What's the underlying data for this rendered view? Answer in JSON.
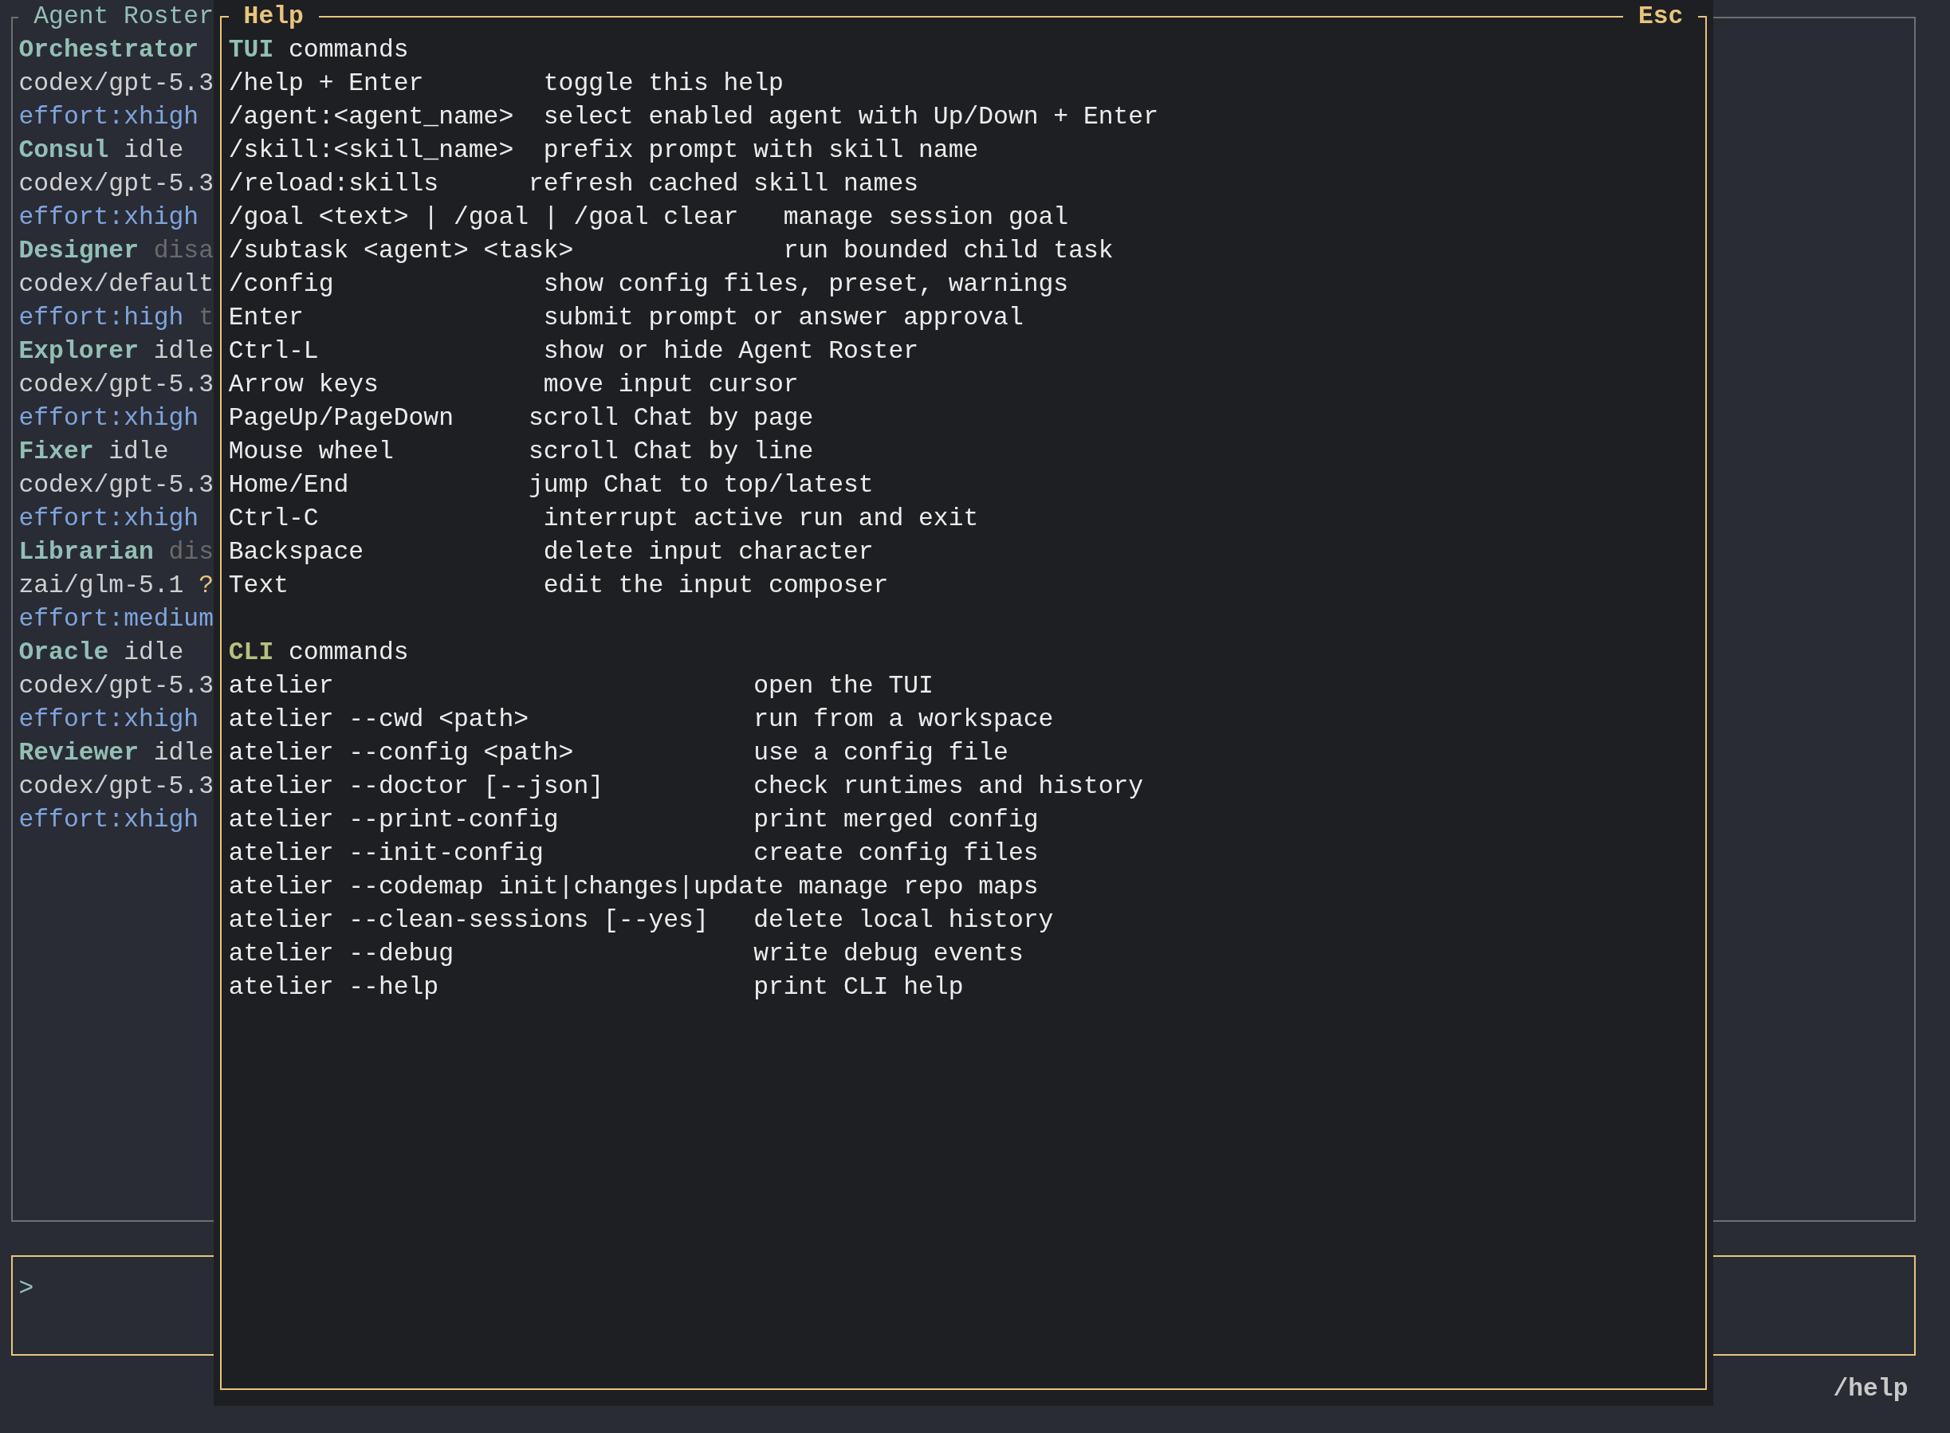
{
  "roster": {
    "title": "Agent Roster",
    "agents": [
      {
        "name": "Orchestrator",
        "model": "codex/gpt-5.3",
        "effort": "effort:xhigh"
      },
      {
        "name": "Consul",
        "status": {
          "text": "idle",
          "disabled": false
        },
        "model": "codex/gpt-5.3",
        "effort": "effort:xhigh"
      },
      {
        "name": "Designer",
        "status": {
          "text": "disa",
          "disabled": true
        },
        "model": "codex/default",
        "effort": "effort:high",
        "effort_trail": "t"
      },
      {
        "name": "Explorer",
        "status": {
          "text": "idle",
          "disabled": false
        },
        "model": "codex/gpt-5.3",
        "effort": "effort:xhigh"
      },
      {
        "name": "Fixer",
        "status": {
          "text": "idle",
          "disabled": false
        },
        "model": "codex/gpt-5.3",
        "effort": "effort:xhigh"
      },
      {
        "name": "Librarian",
        "status": {
          "text": "dis",
          "disabled": true
        },
        "model": "zai/glm-5.1",
        "model_suffix": "?",
        "effort": "effort:medium"
      },
      {
        "name": "Oracle",
        "status": {
          "text": "idle",
          "disabled": false
        },
        "model": "codex/gpt-5.3",
        "effort": "effort:xhigh"
      },
      {
        "name": "Reviewer",
        "status": {
          "text": "idle",
          "disabled": false
        },
        "model": "codex/gpt-5.3",
        "effort": "effort:xhigh"
      }
    ]
  },
  "help_dialog": {
    "title": "Help",
    "close_hint": "Esc",
    "sections": [
      {
        "kind": "tui",
        "heading": "**TUI** commands",
        "rows": [
          {
            "keys": "/help + Enter",
            "action": "toggle this help"
          },
          {
            "keys": "/agent:<agent_name>",
            "action": "select enabled agent with Up/Down + Enter"
          },
          {
            "keys": "/skill:<skill_name>",
            "action": "prefix prompt with skill name"
          },
          {
            "keys": "/reload:skills",
            "action": "refresh cached skill names"
          },
          {
            "keys": "/goal <text> | /goal | /goal clear",
            "action": "manage session goal"
          },
          {
            "keys": "/subtask <agent> <task>",
            "action": "run bounded child task"
          },
          {
            "keys": "/config",
            "action": "show config files, preset, warnings"
          },
          {
            "keys": "Enter",
            "action": "submit prompt or answer approval"
          },
          {
            "keys": "Ctrl-L",
            "action": "show or hide Agent Roster"
          },
          {
            "keys": "Arrow keys",
            "action": "move input cursor"
          },
          {
            "keys": "PageUp/PageDown",
            "action": "scroll Chat by page"
          },
          {
            "keys": "Mouse wheel",
            "action": "scroll Chat by line"
          },
          {
            "keys": "Home/End",
            "action": "jump Chat to top/latest"
          },
          {
            "keys": "Ctrl-C",
            "action": "interrupt active run and exit"
          },
          {
            "keys": "Backspace",
            "action": "delete input character"
          },
          {
            "keys": "Text",
            "action": "edit the input composer"
          }
        ]
      },
      {
        "kind": "cli",
        "heading": "**CLI** commands",
        "rows": [
          {
            "keys": "atelier",
            "action": "open the TUI"
          },
          {
            "keys": "atelier --cwd <path>",
            "action": "run from a workspace"
          },
          {
            "keys": "atelier --config <path>",
            "action": "use a config file"
          },
          {
            "keys": "atelier --doctor [--json]",
            "action": "check runtimes and history"
          },
          {
            "keys": "atelier --print-config",
            "action": "print merged config"
          },
          {
            "keys": "atelier --init-config",
            "action": "create config files"
          },
          {
            "keys": "atelier --codemap init|changes|update",
            "action": "manage repo maps"
          },
          {
            "keys": "atelier --clean-sessions [--yes]",
            "action": "delete local history"
          },
          {
            "keys": "atelier --debug",
            "action": "write debug events"
          },
          {
            "keys": "atelier --help",
            "action": "print CLI help"
          }
        ]
      }
    ]
  },
  "prompt": {
    "symbol": ">"
  },
  "status_bar": {
    "command": "/help"
  }
}
